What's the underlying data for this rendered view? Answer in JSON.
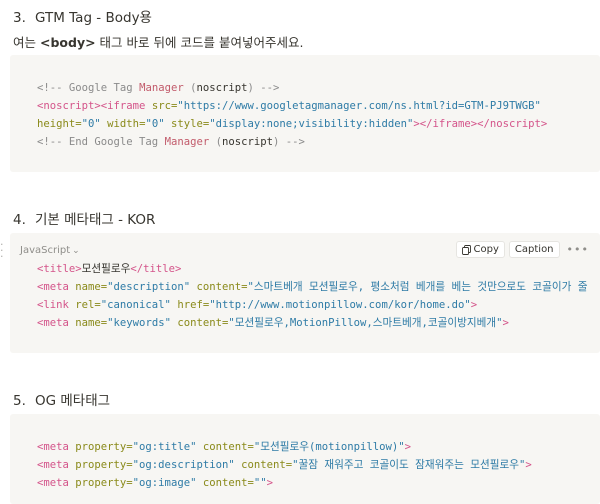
{
  "section3": {
    "number": "3.",
    "title": "GTM Tag - Body용",
    "desc_before": "여는 ",
    "desc_bold": "<body>",
    "desc_after": " 태그 바로 뒤에 코드를 붙여넣어주세요.",
    "code": {
      "l1_open": "<!-- Google Tag ",
      "l1_kw": "Manager",
      "l1_mid": " (",
      "l1_word": "noscript",
      "l1_close": ") -->",
      "l2_tag1": "<noscript>",
      "l2_tag2": "<iframe",
      "l2_attr1": " src=",
      "l2_val1": "\"https://www.googletagmanager.com/ns.html?id=GTM-PJ9TWGB\"",
      "l3_attr1": "height=",
      "l3_val1": "\"0\"",
      "l3_attr2": " width=",
      "l3_val2": "\"0\"",
      "l3_attr3": " style=",
      "l3_val3": "\"display:none;visibility:hidden\"",
      "l3_end": "></iframe></noscript>",
      "l4_open": "<!-- End Google Tag ",
      "l4_kw": "Manager",
      "l4_mid": " (",
      "l4_word": "noscript",
      "l4_close": ") -->"
    }
  },
  "section4": {
    "number": "4.",
    "title": "기본 메타태그 - KOR",
    "language": "JavaScript",
    "copy_label": "Copy",
    "caption_label": "Caption",
    "more_label": "•••",
    "code": {
      "l1_tag_open": "<title>",
      "l1_text": "모션필로우",
      "l1_tag_close": "</title>",
      "l2_tag": "<meta",
      "l2_attr1": " name=",
      "l2_val1": "\"description\"",
      "l2_attr2": " content=",
      "l2_val2": "\"스마트베개 모션필로우, 평소처럼 베개를 베는 것만으로도 코골이가 줄",
      "l3_tag": "<link",
      "l3_attr1": " rel=",
      "l3_val1": "\"canonical\"",
      "l3_attr2": " href=",
      "l3_val2": "\"http://www.motionpillow.com/kor/home.do\"",
      "l3_end": ">",
      "l4_tag": "<meta",
      "l4_attr1": " name=",
      "l4_val1": "\"keywords\"",
      "l4_attr2": " content=",
      "l4_val2": "\"모션필로우,MotionPillow,스마트베개,코골이방지베개\"",
      "l4_end": ">"
    }
  },
  "section5": {
    "number": "5.",
    "title": "OG 메타태그",
    "code": {
      "l1_tag": "<meta",
      "l1_attr1": " property=",
      "l1_val1": "\"og:title\"",
      "l1_attr2": " content=",
      "l1_val2": "\"모션필로우(motionpillow)\"",
      "l1_end": ">",
      "l2_tag": "<meta",
      "l2_attr1": " property=",
      "l2_val1": "\"og:description\"",
      "l2_attr2": " content=",
      "l2_val2": "\"꿀잠 재워주고 코골이도 잠재워주는 모션필로우\"",
      "l2_end": ">",
      "l3_tag": "<meta",
      "l3_attr1": " property=",
      "l3_val1": "\"og:image\"",
      "l3_attr2": " content=",
      "l3_val2": "\"\"",
      "l3_end": ">"
    }
  },
  "colors": {
    "code_bg": "#f7f6f3",
    "tag": "#d4548a",
    "attribute": "#8a8a1a",
    "string": "#2e7ba6",
    "comment": "#8b8b8b"
  }
}
